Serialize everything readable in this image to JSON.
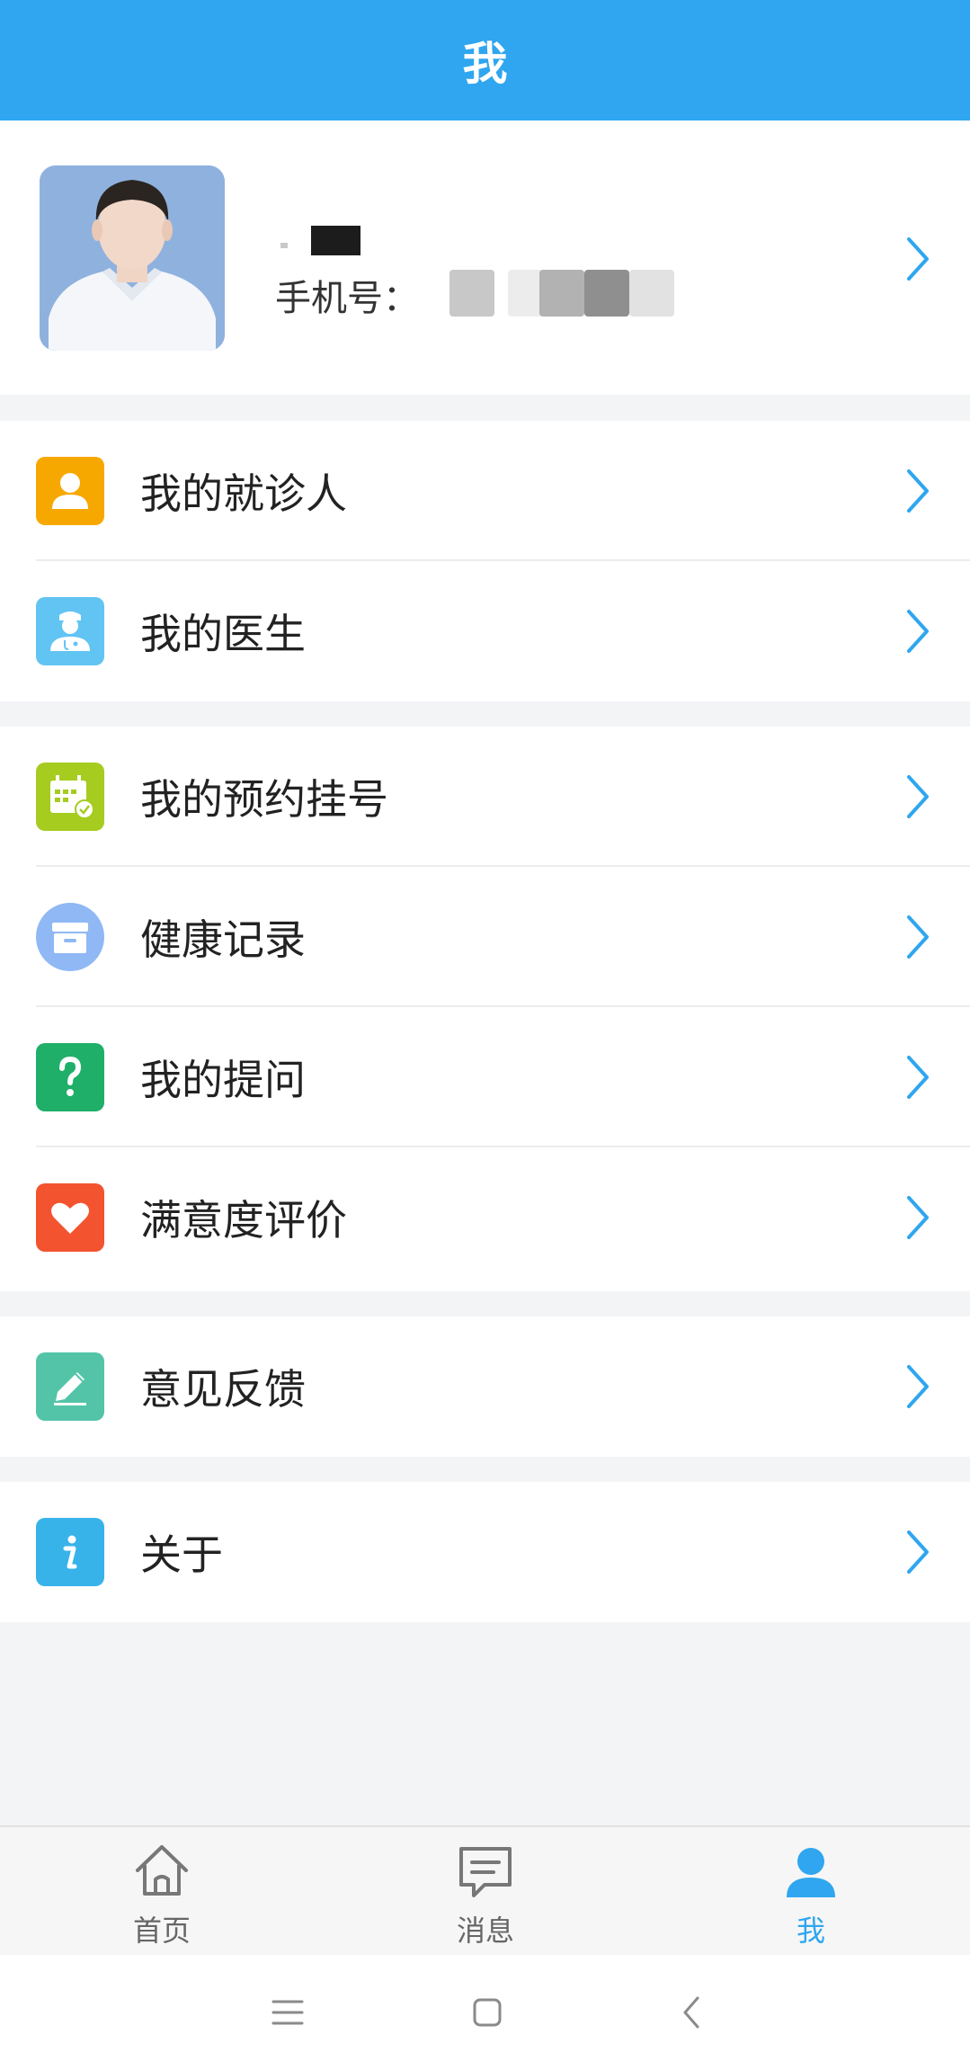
{
  "header": {
    "title": "我"
  },
  "profile": {
    "phone_label": "手机号：",
    "avatar_icon": "doctor-avatar"
  },
  "menu_groups": [
    {
      "items": [
        {
          "label": "我的就诊人",
          "icon": "person-icon",
          "color": "#f7a800"
        },
        {
          "label": "我的医生",
          "icon": "doctor-icon",
          "color": "#62c4f3"
        }
      ]
    },
    {
      "items": [
        {
          "label": "我的预约挂号",
          "icon": "calendar-check-icon",
          "color": "#a5cc1f"
        },
        {
          "label": "健康记录",
          "icon": "archive-box-icon",
          "color": "#8fb8f5"
        },
        {
          "label": "我的提问",
          "icon": "question-icon",
          "color": "#1faf68"
        },
        {
          "label": "满意度评价",
          "icon": "heart-icon",
          "color": "#f3532f"
        }
      ]
    },
    {
      "items": [
        {
          "label": "意见反馈",
          "icon": "pencil-icon",
          "color": "#53c4a8"
        }
      ]
    },
    {
      "items": [
        {
          "label": "关于",
          "icon": "info-icon",
          "color": "#37b3ea"
        }
      ]
    }
  ],
  "tabs": [
    {
      "label": "首页",
      "icon": "home-icon",
      "active": false
    },
    {
      "label": "消息",
      "icon": "message-icon",
      "active": false
    },
    {
      "label": "我",
      "icon": "user-icon",
      "active": true
    }
  ],
  "colors": {
    "accent": "#2fa6ef",
    "chevron": "#2fa6ef"
  },
  "system_nav": {
    "buttons": [
      "menu-icon",
      "home-square-icon",
      "back-icon"
    ]
  }
}
